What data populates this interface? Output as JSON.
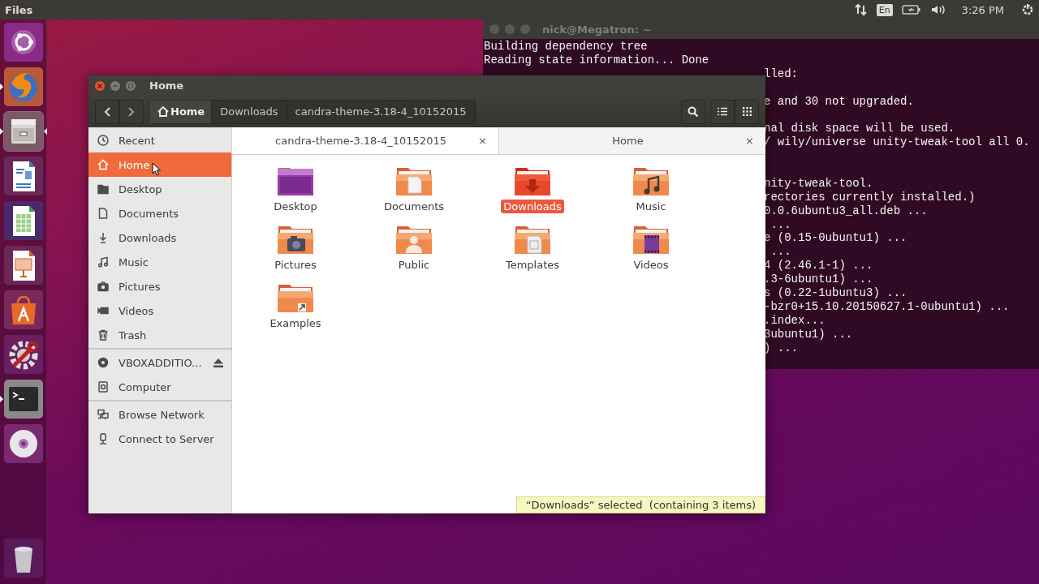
{
  "top_bar": {
    "app_name": "Files",
    "keyboard_layout": "En",
    "clock": "3:26 PM"
  },
  "launcher": [
    {
      "kind": "dash",
      "running": false,
      "focused": false
    },
    {
      "kind": "browser",
      "running": true,
      "focused": false
    },
    {
      "kind": "files",
      "running": true,
      "focused": true
    },
    {
      "kind": "writer",
      "running": false,
      "focused": false
    },
    {
      "kind": "calc",
      "running": false,
      "focused": false
    },
    {
      "kind": "impress",
      "running": false,
      "focused": false
    },
    {
      "kind": "store",
      "running": false,
      "focused": false
    },
    {
      "kind": "tweak",
      "running": false,
      "focused": false
    },
    {
      "kind": "terminal",
      "running": true,
      "focused": false
    },
    {
      "kind": "disc",
      "running": false,
      "focused": false
    },
    {
      "kind": "trash",
      "running": false,
      "focused": false
    }
  ],
  "terminal": {
    "title": "nick@Megatron: ~",
    "lines": [
      {
        "kind": "full",
        "text": "Building dependency tree"
      },
      {
        "kind": "full",
        "text": "Reading state information... Done"
      },
      {
        "kind": "clipped",
        "text": "lled:"
      },
      {
        "kind": "blank"
      },
      {
        "kind": "clipped",
        "text": "e and 30 not upgraded."
      },
      {
        "kind": "blank"
      },
      {
        "kind": "clipped",
        "text": "nal disk space will be used."
      },
      {
        "kind": "clipped",
        "text": "/ wily/universe unity-tweak-tool all 0."
      },
      {
        "kind": "blank"
      },
      {
        "kind": "blank"
      },
      {
        "kind": "clipped",
        "text": "nity-tweak-tool."
      },
      {
        "kind": "clipped",
        "text": "rectories currently installed.)"
      },
      {
        "kind": "clipped",
        "text": "0.0.6ubuntu3_all.deb ..."
      },
      {
        "kind": "clipped",
        "text": " ..."
      },
      {
        "kind": "clipped",
        "text": "e (0.15-0ubuntu1) ..."
      },
      {
        "kind": "clipped",
        "text": " ..."
      },
      {
        "kind": "clipped",
        "text": "4 (2.46.1-1) ..."
      },
      {
        "kind": "clipped",
        "text": ".3-6ubuntu1) ..."
      },
      {
        "kind": "clipped",
        "text": "s (0.22-1ubuntu3) ..."
      },
      {
        "kind": "clipped",
        "text": "-bzr0+15.10.20150627.1-0ubuntu1) ..."
      },
      {
        "kind": "clipped",
        "text": ".index..."
      },
      {
        "kind": "clipped",
        "text": "3ubuntu1) ..."
      },
      {
        "kind": "clipped",
        "text": ") ..."
      }
    ]
  },
  "file_manager": {
    "title": "Home",
    "path": [
      {
        "label": "Home",
        "kind": "home",
        "selected": true
      },
      {
        "label": "Downloads",
        "kind": "folder",
        "selected": false
      },
      {
        "label": "candra-theme-3.18-4_10152015",
        "kind": "folder",
        "selected": false
      }
    ],
    "tabs": [
      {
        "label": "candra-theme-3.18-4_10152015",
        "selected": false,
        "close": "×"
      },
      {
        "label": "Home",
        "selected": true,
        "close": "×"
      }
    ],
    "sidebar": [
      [
        {
          "label": "Recent",
          "kind": "recent",
          "selected": false,
          "ejectable": false
        },
        {
          "label": "Home",
          "kind": "home",
          "selected": true,
          "ejectable": false
        },
        {
          "label": "Desktop",
          "kind": "folder",
          "selected": false,
          "ejectable": false
        },
        {
          "label": "Documents",
          "kind": "document",
          "selected": false,
          "ejectable": false
        },
        {
          "label": "Downloads",
          "kind": "download",
          "selected": false,
          "ejectable": false
        },
        {
          "label": "Music",
          "kind": "music",
          "selected": false,
          "ejectable": false
        },
        {
          "label": "Pictures",
          "kind": "camera",
          "selected": false,
          "ejectable": false
        },
        {
          "label": "Videos",
          "kind": "video",
          "selected": false,
          "ejectable": false
        },
        {
          "label": "Trash",
          "kind": "trash",
          "selected": false,
          "ejectable": false
        }
      ],
      [
        {
          "label": "VBOXADDITIO...",
          "kind": "disc",
          "selected": false,
          "ejectable": true
        },
        {
          "label": "Computer",
          "kind": "computer",
          "selected": false,
          "ejectable": false
        }
      ],
      [
        {
          "label": "Browse Network",
          "kind": "network",
          "selected": false,
          "ejectable": false
        },
        {
          "label": "Connect to Server",
          "kind": "server",
          "selected": false,
          "ejectable": false
        }
      ]
    ],
    "files": [
      {
        "name": "Desktop",
        "kind": "desktop",
        "selected": false
      },
      {
        "name": "Documents",
        "kind": "documents",
        "selected": false
      },
      {
        "name": "Downloads",
        "kind": "downloads",
        "selected": true
      },
      {
        "name": "Music",
        "kind": "music",
        "selected": false
      },
      {
        "name": "Pictures",
        "kind": "pictures",
        "selected": false
      },
      {
        "name": "Public",
        "kind": "public",
        "selected": false
      },
      {
        "name": "Templates",
        "kind": "templates",
        "selected": false
      },
      {
        "name": "Videos",
        "kind": "videos",
        "selected": false
      },
      {
        "name": "Examples",
        "kind": "examples",
        "selected": false
      }
    ],
    "status": "“Downloads” selected  (containing 3 items)"
  }
}
